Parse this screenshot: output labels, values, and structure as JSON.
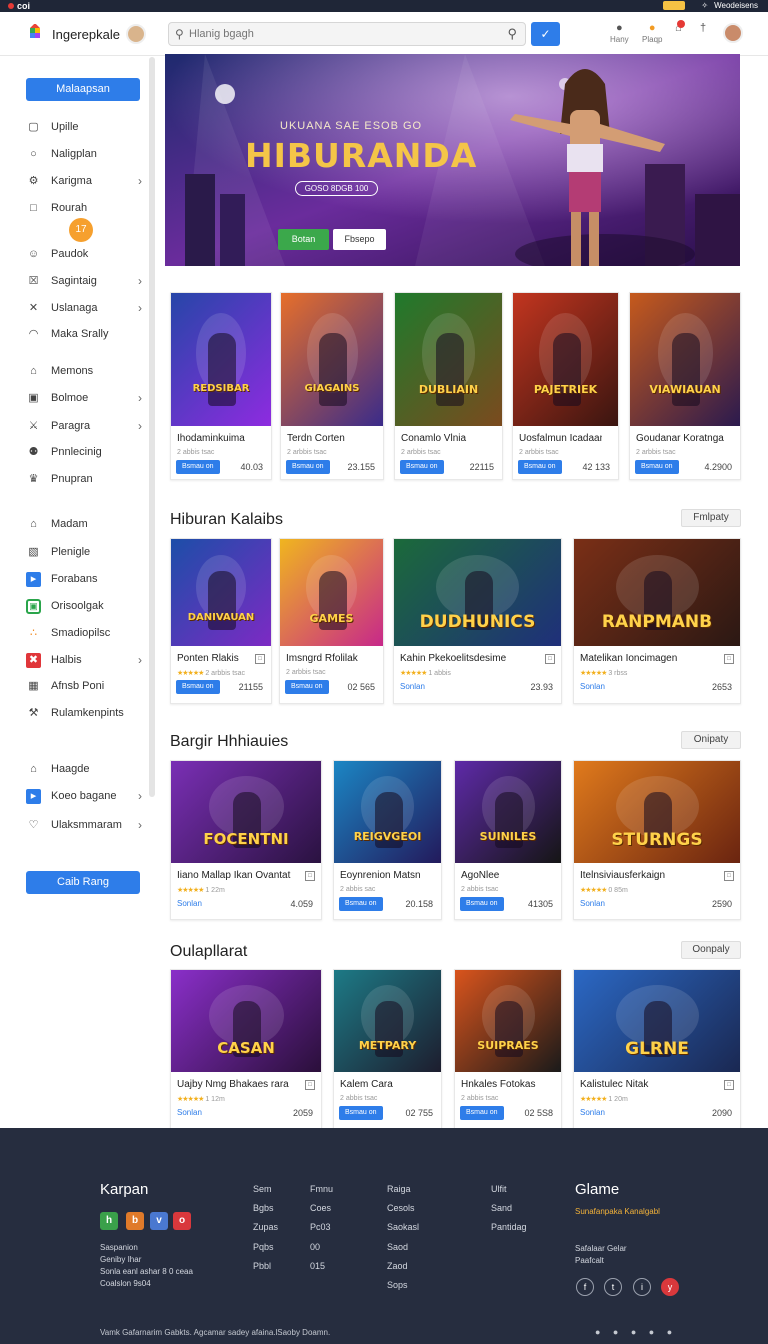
{
  "topbar": {
    "left_text": "coi",
    "right_text": "Weodeisens"
  },
  "header": {
    "brand": "Ingerepkale",
    "search_placeholder": "Hlanig bgagh",
    "icons": [
      {
        "name": "user-icon",
        "label": "Hany"
      },
      {
        "name": "coin-icon",
        "label": "Plaqp"
      },
      {
        "name": "cart-icon",
        "label": ""
      },
      {
        "name": "bell-icon",
        "label": ""
      }
    ]
  },
  "sidebar": {
    "top_button": "Malaapsan",
    "bottom_button": "Caib Rang",
    "coin_badge": "17",
    "items": [
      {
        "label": "Upille",
        "icon": "play-icon",
        "chevron": false
      },
      {
        "label": "Naligplan",
        "icon": "chat-icon",
        "chevron": false
      },
      {
        "label": "Karigma",
        "icon": "gear-icon",
        "chevron": true
      },
      {
        "label": "Rourah",
        "icon": "square-icon",
        "chevron": false
      },
      {
        "label": "Paudok",
        "icon": "person-icon",
        "chevron": false
      },
      {
        "label": "Sagintaig",
        "icon": "close-box-icon",
        "chevron": true
      },
      {
        "label": "Uslanaga",
        "icon": "cross-icon",
        "chevron": true
      },
      {
        "label": "Maka Srally",
        "icon": "mask-icon",
        "chevron": false
      },
      {
        "label": "Memons",
        "icon": "home-icon",
        "chevron": false
      },
      {
        "label": "Bolmoe",
        "icon": "box-icon",
        "chevron": true
      },
      {
        "label": "Paragra",
        "icon": "swords-icon",
        "chevron": true
      },
      {
        "label": "Pnnlecinig",
        "icon": "group-icon",
        "chevron": false
      },
      {
        "label": "Pnupran",
        "icon": "crown-icon",
        "chevron": false
      },
      {
        "label": "Madam",
        "icon": "house-icon",
        "chevron": false
      },
      {
        "label": "Plenigle",
        "icon": "image-icon",
        "chevron": false
      },
      {
        "label": "Forabans",
        "icon": "forward-icon",
        "chevron": false
      },
      {
        "label": "Orisoolgak",
        "icon": "gamepad-icon",
        "chevron": false
      },
      {
        "label": "Smadiopilsc",
        "icon": "dots-icon",
        "chevron": false
      },
      {
        "label": "Halbis",
        "icon": "x-badge-icon",
        "chevron": true
      },
      {
        "label": "Afnsb Poni",
        "icon": "grid-icon",
        "chevron": false
      },
      {
        "label": "Rulamkenpints",
        "icon": "wrench-icon",
        "chevron": false
      },
      {
        "label": "Haagde",
        "icon": "home-icon",
        "chevron": false
      },
      {
        "label": "Koeo bagane",
        "icon": "flag-icon",
        "chevron": true
      },
      {
        "label": "Ulaksmmaram",
        "icon": "heart-icon",
        "chevron": true
      }
    ]
  },
  "hero": {
    "pretitle": "UKUANA SAE ESOB GO",
    "title": "HIBURANDA",
    "pill": "GOSO 8DGB 100",
    "btn_primary": "Botan",
    "btn_secondary": "Fbsepo"
  },
  "featured": [
    {
      "caption": "REDSIBAR",
      "title": "Ihodaminkuima",
      "meta": "2 abbis tsac",
      "btn": "Bsmau on",
      "price": "40.03",
      "colors": [
        "#2646a8",
        "#8e2be0"
      ]
    },
    {
      "caption": "GIAGAINS",
      "title": "Terdn Corten",
      "meta": "2 arbbis tsac",
      "btn": "Bsmau on",
      "price": "23.155",
      "colors": [
        "#e76f2a",
        "#3a2b8a"
      ]
    },
    {
      "caption": "DUBLIAIN",
      "title": "Conamlo Vlnia",
      "meta": "2 arbbis tsac",
      "btn": "Bsmau on",
      "price": "22115",
      "colors": [
        "#1f7a2c",
        "#7b4a1e"
      ]
    },
    {
      "caption": "PAJETRIEK",
      "title": "Uosfalmun Icadaan",
      "meta": "2 arbbis tsac",
      "btn": "Bsmau on",
      "price": "42 133",
      "colors": [
        "#c2351f",
        "#3a1510"
      ]
    },
    {
      "caption": "VIAWIAUAN",
      "title": "Goudanar Koratngan",
      "meta": "2 arbbis tsac",
      "btn": "Bsmau on",
      "price": "4.2900",
      "colors": [
        "#c65a1c",
        "#2b1a4e"
      ]
    }
  ],
  "sections": [
    {
      "title": "Hiburan Kalaibs",
      "button": "Fmlpaty",
      "cards": [
        {
          "caption": "DANIVAUAN",
          "title": "Ponten Rlakis",
          "meta": "2 arbbis tsac",
          "stars": "★★★★★",
          "btn": "Bsmau on",
          "link": "",
          "price": "21155",
          "colors": [
            "#1c4ea8",
            "#7d2ac4"
          ]
        },
        {
          "caption": "GAMES",
          "title": "Imsngrd Rfolilak",
          "meta": "2 arbbis tsac",
          "stars": "",
          "btn": "Bsmau on",
          "link": "",
          "price": "02 565",
          "colors": [
            "#f0b51f",
            "#c7288a"
          ]
        },
        {
          "caption": "DUDHUNICS",
          "title": "Kahin Pkekoelitsdesime",
          "meta": "1 abbis",
          "stars": "★★★★★",
          "btn": "",
          "link": "Sonlan",
          "price": "23.93",
          "colors": [
            "#1b6a3a",
            "#1f2f7a"
          ]
        },
        {
          "caption": "RANPMANB",
          "title": "Matelikan Ioncimagen",
          "meta": "3 rbss",
          "stars": "★★★★★",
          "btn": "",
          "link": "Sonlan",
          "price": "2653",
          "colors": [
            "#7a2f16",
            "#2b1814"
          ]
        }
      ]
    },
    {
      "title": "Bargir Hhhiauies",
      "button": "Onipaty",
      "cards": [
        {
          "caption": "FOCENTNI",
          "title": "Iiano Mallap Ikan Ovantat",
          "meta": "1 22m",
          "stars": "★★★★★",
          "btn": "",
          "link": "Sonlan",
          "price": "4.059",
          "colors": [
            "#7a2fb5",
            "#2a1240"
          ]
        },
        {
          "caption": "REIGVGEOI",
          "title": "Eoynrenion Matsn",
          "meta": "2 abbis sac",
          "stars": "",
          "btn": "Bsmau on",
          "link": "",
          "price": "20.158",
          "colors": [
            "#1b86c4",
            "#231a5c"
          ]
        },
        {
          "caption": "SUINILES",
          "title": "AgoNlee",
          "meta": "2 abbis tsac",
          "stars": "",
          "btn": "Bsmau on",
          "link": "",
          "price": "41305",
          "colors": [
            "#5e2aa8",
            "#151515"
          ]
        },
        {
          "caption": "STURNGS",
          "title": "Itelnsiviausferkaign",
          "meta": "0 85m",
          "stars": "★★★★★",
          "btn": "",
          "link": "Sonlan",
          "price": "2590",
          "colors": [
            "#e07a1c",
            "#6a2410"
          ]
        }
      ]
    },
    {
      "title": "Oulapllarat",
      "button": "Oonpaly",
      "cards": [
        {
          "caption": "CASAN",
          "title": "Uajby Nmg Bhakaes rara",
          "meta": "1 12m",
          "stars": "★★★★★",
          "btn": "",
          "link": "Sonlan",
          "price": "2059",
          "colors": [
            "#8a2fc9",
            "#2a0f3a"
          ]
        },
        {
          "caption": "METPARY",
          "title": "Kalem Cara",
          "meta": "2 abbis tsac",
          "stars": "",
          "btn": "Bsmau on",
          "link": "",
          "price": "02 755",
          "colors": [
            "#1d7a86",
            "#1d1d2e"
          ]
        },
        {
          "caption": "SUIPRAES",
          "title": "Hnkales Fotokas",
          "meta": "2 abbis tsac",
          "stars": "",
          "btn": "Bsmau on",
          "link": "",
          "price": "02 5S8",
          "colors": [
            "#d9541c",
            "#1a1a1a"
          ]
        },
        {
          "caption": "GLRNE",
          "title": "Kalistulec Nitak",
          "meta": "1 20m",
          "stars": "★★★★★",
          "btn": "",
          "link": "Sonlan",
          "price": "2090",
          "colors": [
            "#2b68c4",
            "#1a2852"
          ]
        }
      ]
    }
  ],
  "footer": {
    "brand": "Karpan",
    "contact": [
      "Saspanion",
      "Geniby Ihar",
      "Sonla eanl ashar 8 0 ceaa",
      "Coalslon 9s04"
    ],
    "columns": [
      [
        "Sem",
        "Bgbs",
        "Zupas",
        "Pqbs",
        "Pbbl"
      ],
      [
        "Fmnu",
        "Coes",
        "Pc03",
        "00",
        "015"
      ],
      [
        "Raiga",
        "Cesols",
        "Saokasl",
        "Saod",
        "Zaod",
        "Sops"
      ],
      [
        "Ulfit",
        "Sand",
        "Pantidag"
      ]
    ],
    "right_title": "Glame",
    "right_link": "Sunafanpaka Kanalgabl",
    "right_text": [
      "Safalaar Gelar",
      "Paafcalt"
    ],
    "socials": [
      "f",
      "t",
      "i",
      "y"
    ],
    "copyright": "Vamk Gafarnarim Gabkts. Agcamar sadey afaina.lSaoby Doamn.",
    "bottom_icons": "● ● ● ● ●"
  },
  "accent": "#2e7de9"
}
